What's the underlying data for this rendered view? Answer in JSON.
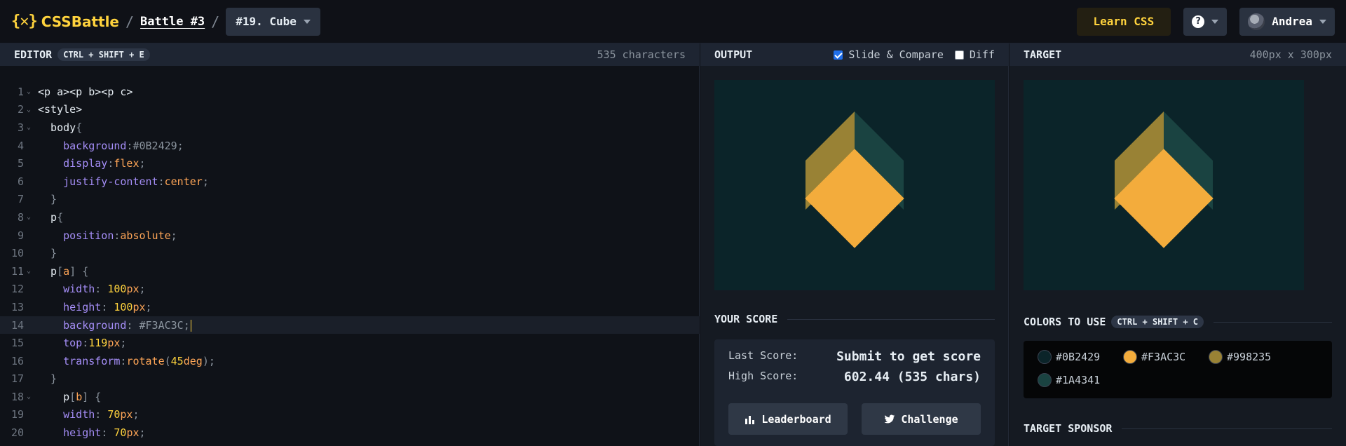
{
  "header": {
    "logo_mark": "{✕}",
    "logo_text": "CSSBattle",
    "sep": "/",
    "battle": "Battle #3",
    "target_select": "#19. Cube",
    "learn_css": "Learn CSS",
    "help": "?",
    "user": "Andrea"
  },
  "editor": {
    "title": "EDITOR",
    "shortcut": "CTRL + SHIFT + E",
    "char_count": "535 characters",
    "lines": [
      {
        "n": "1",
        "fold": true,
        "segs": [
          [
            "t-tag",
            "<p a><p b><p c>"
          ]
        ]
      },
      {
        "n": "2",
        "fold": true,
        "segs": [
          [
            "t-tag",
            "<style>"
          ]
        ]
      },
      {
        "n": "3",
        "fold": true,
        "segs": [
          [
            "t-sel",
            "  body"
          ],
          [
            "t-punc",
            "{"
          ]
        ]
      },
      {
        "n": "4",
        "fold": false,
        "segs": [
          [
            "t-prop",
            "    background"
          ],
          [
            "t-punc",
            ":"
          ],
          [
            "t-hex",
            "#0B2429"
          ],
          [
            "t-punc",
            ";"
          ]
        ]
      },
      {
        "n": "5",
        "fold": false,
        "segs": [
          [
            "t-prop",
            "    display"
          ],
          [
            "t-punc",
            ":"
          ],
          [
            "t-val",
            "flex"
          ],
          [
            "t-punc",
            ";"
          ]
        ]
      },
      {
        "n": "6",
        "fold": false,
        "segs": [
          [
            "t-prop",
            "    justify-content"
          ],
          [
            "t-punc",
            ":"
          ],
          [
            "t-val",
            "center"
          ],
          [
            "t-punc",
            ";"
          ]
        ]
      },
      {
        "n": "7",
        "fold": false,
        "segs": [
          [
            "t-punc",
            "  }"
          ]
        ]
      },
      {
        "n": "8",
        "fold": true,
        "segs": [
          [
            "t-sel",
            "  p"
          ],
          [
            "t-punc",
            "{"
          ]
        ]
      },
      {
        "n": "9",
        "fold": false,
        "segs": [
          [
            "t-prop",
            "    position"
          ],
          [
            "t-punc",
            ":"
          ],
          [
            "t-val",
            "absolute"
          ],
          [
            "t-punc",
            ";"
          ]
        ]
      },
      {
        "n": "10",
        "fold": false,
        "segs": [
          [
            "t-punc",
            "  }"
          ]
        ]
      },
      {
        "n": "11",
        "fold": true,
        "segs": [
          [
            "t-sel",
            "  p"
          ],
          [
            "t-punc",
            "["
          ],
          [
            "t-val",
            "a"
          ],
          [
            "t-punc",
            "] {"
          ]
        ]
      },
      {
        "n": "12",
        "fold": false,
        "segs": [
          [
            "t-prop",
            "    width"
          ],
          [
            "t-punc",
            ": "
          ],
          [
            "t-num",
            "100"
          ],
          [
            "t-val",
            "px"
          ],
          [
            "t-punc",
            ";"
          ]
        ]
      },
      {
        "n": "13",
        "fold": false,
        "segs": [
          [
            "t-prop",
            "    height"
          ],
          [
            "t-punc",
            ": "
          ],
          [
            "t-num",
            "100"
          ],
          [
            "t-val",
            "px"
          ],
          [
            "t-punc",
            ";"
          ]
        ]
      },
      {
        "n": "14",
        "fold": false,
        "active": true,
        "segs": [
          [
            "t-prop",
            "    background"
          ],
          [
            "t-punc",
            ": "
          ],
          [
            "t-hex",
            "#F3AC3C"
          ],
          [
            "t-punc",
            ";"
          ]
        ]
      },
      {
        "n": "15",
        "fold": false,
        "segs": [
          [
            "t-prop",
            "    top"
          ],
          [
            "t-punc",
            ":"
          ],
          [
            "t-num",
            "119"
          ],
          [
            "t-val",
            "px"
          ],
          [
            "t-punc",
            ";"
          ]
        ]
      },
      {
        "n": "16",
        "fold": false,
        "segs": [
          [
            "t-prop",
            "    transform"
          ],
          [
            "t-punc",
            ":"
          ],
          [
            "t-val",
            "rotate"
          ],
          [
            "t-punc",
            "("
          ],
          [
            "t-num",
            "45"
          ],
          [
            "t-val",
            "deg"
          ],
          [
            "t-punc",
            ");"
          ]
        ]
      },
      {
        "n": "17",
        "fold": false,
        "segs": [
          [
            "t-punc",
            "  }"
          ]
        ]
      },
      {
        "n": "18",
        "fold": true,
        "segs": [
          [
            "t-sel",
            "    p"
          ],
          [
            "t-punc",
            "["
          ],
          [
            "t-val",
            "b"
          ],
          [
            "t-punc",
            "] {"
          ]
        ]
      },
      {
        "n": "19",
        "fold": false,
        "segs": [
          [
            "t-prop",
            "    width"
          ],
          [
            "t-punc",
            ": "
          ],
          [
            "t-num",
            "70"
          ],
          [
            "t-val",
            "px"
          ],
          [
            "t-punc",
            ";"
          ]
        ]
      },
      {
        "n": "20",
        "fold": false,
        "segs": [
          [
            "t-prop",
            "    height"
          ],
          [
            "t-punc",
            ": "
          ],
          [
            "t-num",
            "70"
          ],
          [
            "t-val",
            "px"
          ],
          [
            "t-punc",
            ";"
          ]
        ]
      }
    ]
  },
  "output": {
    "title": "OUTPUT",
    "slide_compare": "Slide & Compare",
    "diff": "Diff",
    "your_score": "YOUR SCORE",
    "last_score_label": "Last Score:",
    "last_score_value": "Submit to get score",
    "high_score_label": "High Score:",
    "high_score_value": "602.44 (535 chars)",
    "leaderboard": "Leaderboard",
    "challenge": "Challenge"
  },
  "target": {
    "title": "TARGET",
    "size": "400px x 300px",
    "colors_title": "COLORS TO USE",
    "colors_shortcut": "CTRL + SHIFT + C",
    "colors": [
      {
        "hex": "#0B2429",
        "swatch": "#0B2429"
      },
      {
        "hex": "#F3AC3C",
        "swatch": "#F3AC3C"
      },
      {
        "hex": "#998235",
        "swatch": "#998235"
      },
      {
        "hex": "#1A4341",
        "swatch": "#1A4341"
      }
    ],
    "sponsor_title": "TARGET SPONSOR"
  }
}
